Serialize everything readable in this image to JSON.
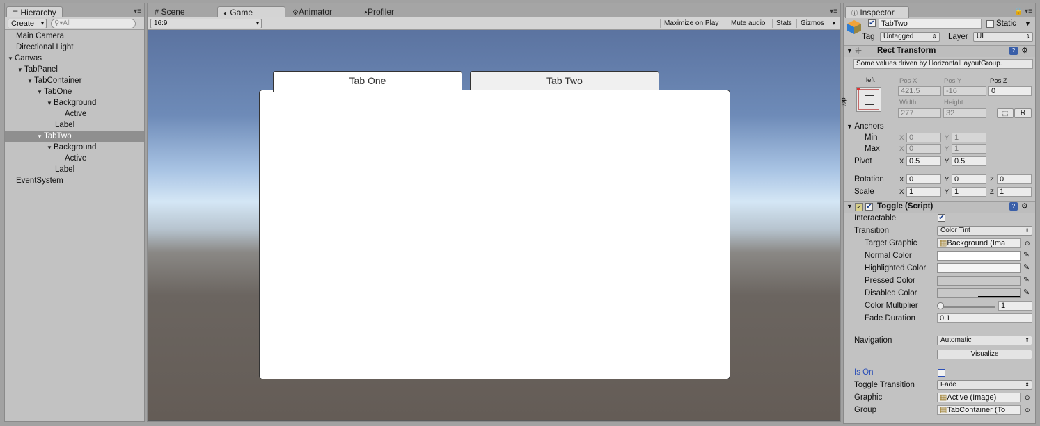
{
  "hierarchy": {
    "tab_label": "Hierarchy",
    "create_label": "Create",
    "search_placeholder": "All",
    "items": [
      {
        "label": "Main Camera"
      },
      {
        "label": "Directional Light"
      },
      {
        "label": "Canvas"
      },
      {
        "label": "TabPanel"
      },
      {
        "label": "TabContainer"
      },
      {
        "label": "TabOne"
      },
      {
        "label": "Background"
      },
      {
        "label": "Active"
      },
      {
        "label": "Label"
      },
      {
        "label": "TabTwo"
      },
      {
        "label": "Background"
      },
      {
        "label": "Active"
      },
      {
        "label": "Label"
      },
      {
        "label": "EventSystem"
      }
    ]
  },
  "center": {
    "tabs": [
      {
        "label": "Scene"
      },
      {
        "label": "Game"
      },
      {
        "label": "Animator"
      },
      {
        "label": "Profiler"
      }
    ],
    "aspect": "16:9",
    "toolbar": {
      "maximize": "Maximize on Play",
      "mute": "Mute audio",
      "stats": "Stats",
      "gizmos": "Gizmos"
    },
    "game": {
      "tab_one": "Tab One",
      "tab_two": "Tab Two"
    }
  },
  "inspector": {
    "tab_label": "Inspector",
    "object_name": "TabTwo",
    "static_label": "Static",
    "tag_label": "Tag",
    "tag_value": "Untagged",
    "layer_label": "Layer",
    "layer_value": "UI",
    "rect": {
      "title": "Rect Transform",
      "note": "Some values driven by HorizontalLayoutGroup.",
      "anchor_h": "left",
      "anchor_v": "top",
      "posx_label": "Pos X",
      "posx": "421.5",
      "posy_label": "Pos Y",
      "posy": "-16",
      "posz_label": "Pos Z",
      "posz": "0",
      "width_label": "Width",
      "width": "277",
      "height_label": "Height",
      "height": "32",
      "r_label": "R",
      "anchors_label": "Anchors",
      "min_label": "Min",
      "min_x": "0",
      "min_y": "1",
      "max_label": "Max",
      "max_x": "0",
      "max_y": "1",
      "pivot_label": "Pivot",
      "pivot_x": "0.5",
      "pivot_y": "0.5",
      "rotation_label": "Rotation",
      "rot_x": "0",
      "rot_y": "0",
      "rot_z": "0",
      "scale_label": "Scale",
      "scale_x": "1",
      "scale_y": "1",
      "scale_z": "1",
      "x": "X",
      "y": "Y",
      "z": "Z"
    },
    "toggle": {
      "title": "Toggle (Script)",
      "interactable_label": "Interactable",
      "transition_label": "Transition",
      "transition_value": "Color Tint",
      "target_graphic_label": "Target Graphic",
      "target_graphic_value": "Background (Ima",
      "normal_color_label": "Normal Color",
      "highlighted_color_label": "Highlighted Color",
      "pressed_color_label": "Pressed Color",
      "disabled_color_label": "Disabled Color",
      "color_multiplier_label": "Color Multiplier",
      "color_multiplier_value": "1",
      "color_multiplier_fraction": 0,
      "fade_duration_label": "Fade Duration",
      "fade_duration_value": "0.1",
      "navigation_label": "Navigation",
      "navigation_value": "Automatic",
      "visualize_label": "Visualize",
      "is_on_label": "Is On",
      "toggle_transition_label": "Toggle Transition",
      "toggle_transition_value": "Fade",
      "graphic_label": "Graphic",
      "graphic_value": "Active (Image)",
      "group_label": "Group",
      "group_value": "TabContainer (To"
    }
  },
  "colors": {
    "normal": "#ffffff",
    "highlighted": "#f5f5f5",
    "pressed": "#c8c8c8",
    "disabled": "#c8c8c8",
    "is_on_label": "#2b4fb7"
  }
}
